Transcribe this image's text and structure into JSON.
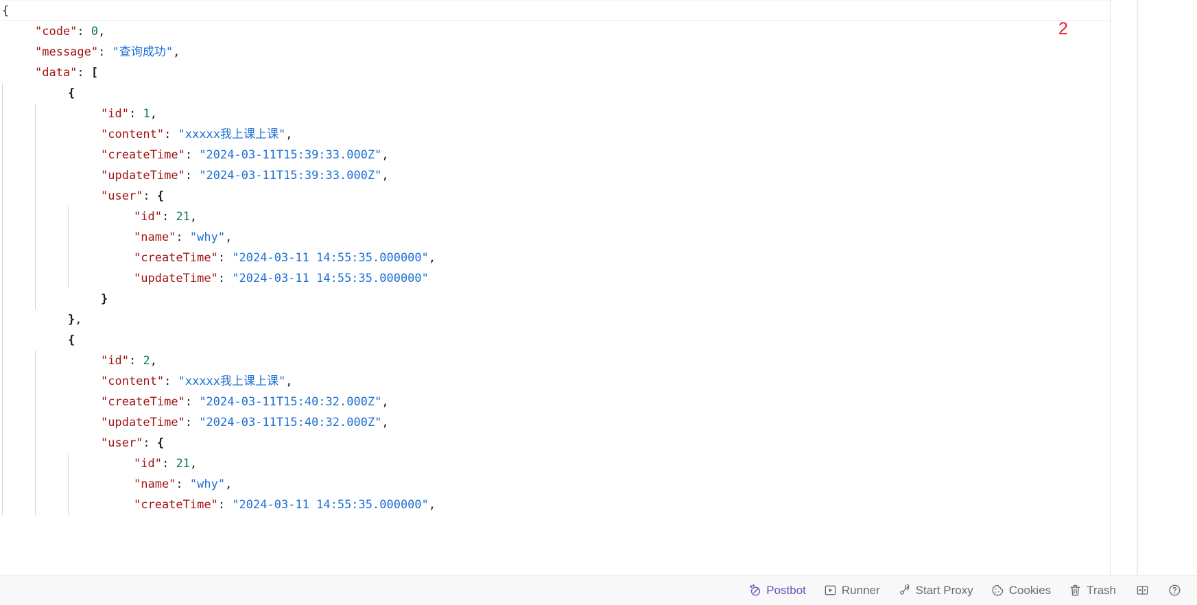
{
  "viewer": {
    "sticky_header_text": "{",
    "language": "json",
    "code_lines": [
      {
        "indent": 1,
        "guides": 0,
        "tokens": [
          {
            "t": "k",
            "v": "\"code\""
          },
          {
            "t": "p",
            "v": ": "
          },
          {
            "t": "n",
            "v": "0"
          },
          {
            "t": "p",
            "v": ","
          }
        ]
      },
      {
        "indent": 1,
        "guides": 0,
        "tokens": [
          {
            "t": "k",
            "v": "\"message\""
          },
          {
            "t": "p",
            "v": ": "
          },
          {
            "t": "s",
            "v": "\"查询成功\""
          },
          {
            "t": "p",
            "v": ","
          }
        ]
      },
      {
        "indent": 1,
        "guides": 0,
        "tokens": [
          {
            "t": "k",
            "v": "\"data\""
          },
          {
            "t": "p",
            "v": ": "
          },
          {
            "t": "b",
            "v": "["
          }
        ]
      },
      {
        "indent": 2,
        "guides": 1,
        "tokens": [
          {
            "t": "b",
            "v": "{"
          }
        ]
      },
      {
        "indent": 3,
        "guides": 2,
        "tokens": [
          {
            "t": "k",
            "v": "\"id\""
          },
          {
            "t": "p",
            "v": ": "
          },
          {
            "t": "n",
            "v": "1"
          },
          {
            "t": "p",
            "v": ","
          }
        ]
      },
      {
        "indent": 3,
        "guides": 2,
        "tokens": [
          {
            "t": "k",
            "v": "\"content\""
          },
          {
            "t": "p",
            "v": ": "
          },
          {
            "t": "s",
            "v": "\"xxxxx我上课上课\""
          },
          {
            "t": "p",
            "v": ","
          }
        ]
      },
      {
        "indent": 3,
        "guides": 2,
        "tokens": [
          {
            "t": "k",
            "v": "\"createTime\""
          },
          {
            "t": "p",
            "v": ": "
          },
          {
            "t": "s",
            "v": "\"2024-03-11T15:39:33.000Z\""
          },
          {
            "t": "p",
            "v": ","
          }
        ]
      },
      {
        "indent": 3,
        "guides": 2,
        "tokens": [
          {
            "t": "k",
            "v": "\"updateTime\""
          },
          {
            "t": "p",
            "v": ": "
          },
          {
            "t": "s",
            "v": "\"2024-03-11T15:39:33.000Z\""
          },
          {
            "t": "p",
            "v": ","
          }
        ]
      },
      {
        "indent": 3,
        "guides": 2,
        "tokens": [
          {
            "t": "k",
            "v": "\"user\""
          },
          {
            "t": "p",
            "v": ": "
          },
          {
            "t": "b",
            "v": "{"
          }
        ]
      },
      {
        "indent": 4,
        "guides": 3,
        "tokens": [
          {
            "t": "k",
            "v": "\"id\""
          },
          {
            "t": "p",
            "v": ": "
          },
          {
            "t": "n",
            "v": "21"
          },
          {
            "t": "p",
            "v": ","
          }
        ]
      },
      {
        "indent": 4,
        "guides": 3,
        "tokens": [
          {
            "t": "k",
            "v": "\"name\""
          },
          {
            "t": "p",
            "v": ": "
          },
          {
            "t": "s",
            "v": "\"why\""
          },
          {
            "t": "p",
            "v": ","
          }
        ]
      },
      {
        "indent": 4,
        "guides": 3,
        "tokens": [
          {
            "t": "k",
            "v": "\"createTime\""
          },
          {
            "t": "p",
            "v": ": "
          },
          {
            "t": "s",
            "v": "\"2024-03-11 14:55:35.000000\""
          },
          {
            "t": "p",
            "v": ","
          }
        ]
      },
      {
        "indent": 4,
        "guides": 3,
        "tokens": [
          {
            "t": "k",
            "v": "\"updateTime\""
          },
          {
            "t": "p",
            "v": ": "
          },
          {
            "t": "s",
            "v": "\"2024-03-11 14:55:35.000000\""
          }
        ]
      },
      {
        "indent": 3,
        "guides": 2,
        "tokens": [
          {
            "t": "b",
            "v": "}"
          }
        ]
      },
      {
        "indent": 2,
        "guides": 1,
        "tokens": [
          {
            "t": "b",
            "v": "}"
          },
          {
            "t": "p",
            "v": ","
          }
        ]
      },
      {
        "indent": 2,
        "guides": 1,
        "tokens": [
          {
            "t": "b",
            "v": "{"
          }
        ]
      },
      {
        "indent": 3,
        "guides": 2,
        "tokens": [
          {
            "t": "k",
            "v": "\"id\""
          },
          {
            "t": "p",
            "v": ": "
          },
          {
            "t": "n",
            "v": "2"
          },
          {
            "t": "p",
            "v": ","
          }
        ]
      },
      {
        "indent": 3,
        "guides": 2,
        "tokens": [
          {
            "t": "k",
            "v": "\"content\""
          },
          {
            "t": "p",
            "v": ": "
          },
          {
            "t": "s",
            "v": "\"xxxxx我上课上课\""
          },
          {
            "t": "p",
            "v": ","
          }
        ]
      },
      {
        "indent": 3,
        "guides": 2,
        "tokens": [
          {
            "t": "k",
            "v": "\"createTime\""
          },
          {
            "t": "p",
            "v": ": "
          },
          {
            "t": "s",
            "v": "\"2024-03-11T15:40:32.000Z\""
          },
          {
            "t": "p",
            "v": ","
          }
        ]
      },
      {
        "indent": 3,
        "guides": 2,
        "tokens": [
          {
            "t": "k",
            "v": "\"updateTime\""
          },
          {
            "t": "p",
            "v": ": "
          },
          {
            "t": "s",
            "v": "\"2024-03-11T15:40:32.000Z\""
          },
          {
            "t": "p",
            "v": ","
          }
        ]
      },
      {
        "indent": 3,
        "guides": 2,
        "tokens": [
          {
            "t": "k",
            "v": "\"user\""
          },
          {
            "t": "p",
            "v": ": "
          },
          {
            "t": "b",
            "v": "{"
          }
        ]
      },
      {
        "indent": 4,
        "guides": 3,
        "tokens": [
          {
            "t": "k",
            "v": "\"id\""
          },
          {
            "t": "p",
            "v": ": "
          },
          {
            "t": "n",
            "v": "21"
          },
          {
            "t": "p",
            "v": ","
          }
        ]
      },
      {
        "indent": 4,
        "guides": 3,
        "tokens": [
          {
            "t": "k",
            "v": "\"name\""
          },
          {
            "t": "p",
            "v": ": "
          },
          {
            "t": "s",
            "v": "\"why\""
          },
          {
            "t": "p",
            "v": ","
          }
        ]
      },
      {
        "indent": 4,
        "guides": 3,
        "tokens": [
          {
            "t": "k",
            "v": "\"createTime\""
          },
          {
            "t": "p",
            "v": ": "
          },
          {
            "t": "s",
            "v": "\"2024-03-11 14:55:35.000000\""
          },
          {
            "t": "p",
            "v": ","
          }
        ]
      }
    ]
  },
  "annotation": {
    "marker_label": "2",
    "marker_color": "#e8202a"
  },
  "footer": {
    "buttons": [
      {
        "icon": "postbot-icon",
        "label": "Postbot",
        "accent": "#6b4fbb"
      },
      {
        "icon": "runner-icon",
        "label": "Runner",
        "accent": "#6b6b6b"
      },
      {
        "icon": "proxy-icon",
        "label": "Start Proxy",
        "accent": "#6b6b6b"
      },
      {
        "icon": "cookie-icon",
        "label": "Cookies",
        "accent": "#6b6b6b"
      },
      {
        "icon": "trash-icon",
        "label": "Trash",
        "accent": "#6b6b6b"
      }
    ],
    "icon_buttons": [
      {
        "icon": "layout-panels-icon",
        "label": ""
      },
      {
        "icon": "help-circle-icon",
        "label": ""
      }
    ]
  },
  "colors": {
    "json_key": "#a31515",
    "json_string": "#1d6fd4",
    "json_number": "#0b7a55",
    "json_punct": "#1a1a1a",
    "indent_guide": "#d4d4d4",
    "footer_bg": "#f8f8f8",
    "divider": "#e3e3e3"
  }
}
